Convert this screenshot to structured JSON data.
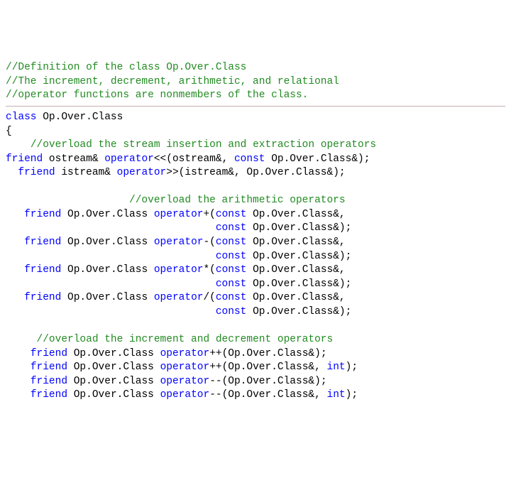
{
  "lines": [
    [
      {
        "cls": "g",
        "text": "//Definition of the class Op.Over.Class"
      }
    ],
    [
      {
        "cls": "g",
        "text": "//The increment, decrement, arithmetic, and relational"
      }
    ],
    [
      {
        "cls": "g",
        "text": "//operator functions are nonmembers of the class."
      }
    ],
    "HR",
    [
      {
        "cls": "b",
        "text": "class"
      },
      {
        "cls": "k",
        "text": " Op.Over.Class"
      }
    ],
    [
      {
        "cls": "k",
        "text": "{"
      }
    ],
    [
      {
        "cls": "k",
        "text": "    "
      },
      {
        "cls": "g",
        "text": "//overload the stream insertion and extraction operators"
      }
    ],
    [
      {
        "cls": "b",
        "text": "friend"
      },
      {
        "cls": "k",
        "text": " ostream& "
      },
      {
        "cls": "b",
        "text": "operator"
      },
      {
        "cls": "k",
        "text": "<<(ostream&, "
      },
      {
        "cls": "b",
        "text": "const"
      },
      {
        "cls": "k",
        "text": " Op.Over.Class&);"
      }
    ],
    [
      {
        "cls": "k",
        "text": "  "
      },
      {
        "cls": "b",
        "text": "friend"
      },
      {
        "cls": "k",
        "text": " istream& "
      },
      {
        "cls": "b",
        "text": "operator"
      },
      {
        "cls": "k",
        "text": ">>(istream&, Op.Over.Class&);"
      }
    ],
    [
      {
        "cls": "k",
        "text": " "
      }
    ],
    [
      {
        "cls": "k",
        "text": "                    "
      },
      {
        "cls": "g",
        "text": "//overload the arithmetic operators"
      }
    ],
    [
      {
        "cls": "k",
        "text": "   "
      },
      {
        "cls": "b",
        "text": "friend"
      },
      {
        "cls": "k",
        "text": " Op.Over.Class "
      },
      {
        "cls": "b",
        "text": "operator"
      },
      {
        "cls": "k",
        "text": "+("
      },
      {
        "cls": "b",
        "text": "const"
      },
      {
        "cls": "k",
        "text": " Op.Over.Class&,"
      }
    ],
    [
      {
        "cls": "k",
        "text": "                                  "
      },
      {
        "cls": "b",
        "text": "const"
      },
      {
        "cls": "k",
        "text": " Op.Over.Class&);"
      }
    ],
    [
      {
        "cls": "k",
        "text": "   "
      },
      {
        "cls": "b",
        "text": "friend"
      },
      {
        "cls": "k",
        "text": " Op.Over.Class "
      },
      {
        "cls": "b",
        "text": "operator"
      },
      {
        "cls": "k",
        "text": "-("
      },
      {
        "cls": "b",
        "text": "const"
      },
      {
        "cls": "k",
        "text": " Op.Over.Class&,"
      }
    ],
    [
      {
        "cls": "k",
        "text": "                                  "
      },
      {
        "cls": "b",
        "text": "const"
      },
      {
        "cls": "k",
        "text": " Op.Over.Class&);"
      }
    ],
    [
      {
        "cls": "k",
        "text": "   "
      },
      {
        "cls": "b",
        "text": "friend"
      },
      {
        "cls": "k",
        "text": " Op.Over.Class "
      },
      {
        "cls": "b",
        "text": "operator"
      },
      {
        "cls": "k",
        "text": "*("
      },
      {
        "cls": "b",
        "text": "const"
      },
      {
        "cls": "k",
        "text": " Op.Over.Class&,"
      }
    ],
    [
      {
        "cls": "k",
        "text": "                                  "
      },
      {
        "cls": "b",
        "text": "const"
      },
      {
        "cls": "k",
        "text": " Op.Over.Class&);"
      }
    ],
    [
      {
        "cls": "k",
        "text": "   "
      },
      {
        "cls": "b",
        "text": "friend"
      },
      {
        "cls": "k",
        "text": " Op.Over.Class "
      },
      {
        "cls": "b",
        "text": "operator"
      },
      {
        "cls": "k",
        "text": "/("
      },
      {
        "cls": "b",
        "text": "const"
      },
      {
        "cls": "k",
        "text": " Op.Over.Class&,"
      }
    ],
    [
      {
        "cls": "k",
        "text": "                                  "
      },
      {
        "cls": "b",
        "text": "const"
      },
      {
        "cls": "k",
        "text": " Op.Over.Class&);"
      }
    ],
    [
      {
        "cls": "k",
        "text": " "
      }
    ],
    [
      {
        "cls": "k",
        "text": "     "
      },
      {
        "cls": "g",
        "text": "//overload the increment and decrement operators"
      }
    ],
    [
      {
        "cls": "k",
        "text": "    "
      },
      {
        "cls": "b",
        "text": "friend"
      },
      {
        "cls": "k",
        "text": " Op.Over.Class "
      },
      {
        "cls": "b",
        "text": "operator"
      },
      {
        "cls": "k",
        "text": "++(Op.Over.Class&);"
      }
    ],
    [
      {
        "cls": "k",
        "text": "    "
      },
      {
        "cls": "b",
        "text": "friend"
      },
      {
        "cls": "k",
        "text": " Op.Over.Class "
      },
      {
        "cls": "b",
        "text": "operator"
      },
      {
        "cls": "k",
        "text": "++(Op.Over.Class&, "
      },
      {
        "cls": "b",
        "text": "int"
      },
      {
        "cls": "k",
        "text": ");"
      }
    ],
    [
      {
        "cls": "k",
        "text": "    "
      },
      {
        "cls": "b",
        "text": "friend"
      },
      {
        "cls": "k",
        "text": " Op.Over.Class "
      },
      {
        "cls": "b",
        "text": "operator"
      },
      {
        "cls": "k",
        "text": "--(Op.Over.Class&);"
      }
    ],
    [
      {
        "cls": "k",
        "text": "    "
      },
      {
        "cls": "b",
        "text": "friend"
      },
      {
        "cls": "k",
        "text": " Op.Over.Class "
      },
      {
        "cls": "b",
        "text": "operator"
      },
      {
        "cls": "k",
        "text": "--(Op.Over.Class&, "
      },
      {
        "cls": "b",
        "text": "int"
      },
      {
        "cls": "k",
        "text": ");"
      }
    ]
  ]
}
